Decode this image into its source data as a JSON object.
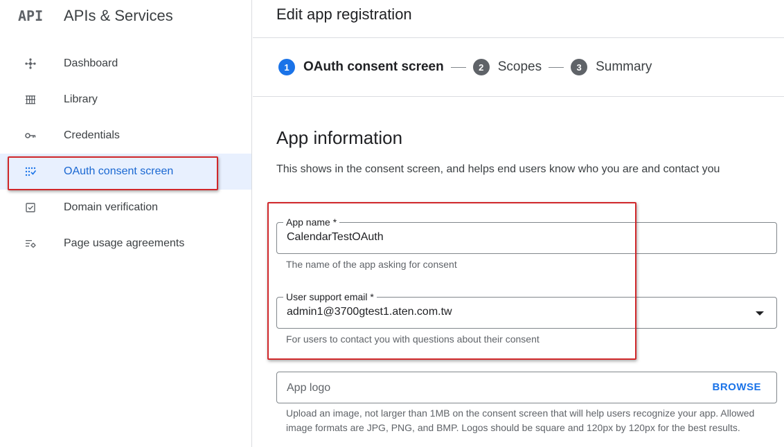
{
  "brand": {
    "logo": "API",
    "title": "APIs & Services"
  },
  "sidebar": {
    "items": [
      {
        "label": "Dashboard",
        "icon": "dashboard-icon"
      },
      {
        "label": "Library",
        "icon": "library-icon"
      },
      {
        "label": "Credentials",
        "icon": "key-icon"
      },
      {
        "label": "OAuth consent screen",
        "icon": "consent-icon",
        "active": true
      },
      {
        "label": "Domain verification",
        "icon": "checkbox-icon"
      },
      {
        "label": "Page usage agreements",
        "icon": "settings-list-icon"
      }
    ]
  },
  "page": {
    "title": "Edit app registration"
  },
  "stepper": {
    "steps": [
      {
        "num": "1",
        "label": "OAuth consent screen",
        "active": true
      },
      {
        "num": "2",
        "label": "Scopes",
        "active": false
      },
      {
        "num": "3",
        "label": "Summary",
        "active": false
      }
    ]
  },
  "app_info": {
    "title": "App information",
    "desc": "This shows in the consent screen, and helps end users know who you are and contact you"
  },
  "form": {
    "app_name": {
      "label": "App name *",
      "value": "CalendarTestOAuth",
      "helper": "The name of the app asking for consent"
    },
    "support_email": {
      "label": "User support email *",
      "value": "admin1@3700gtest1.aten.com.tw",
      "helper": "For users to contact you with questions about their consent"
    },
    "app_logo": {
      "placeholder": "App logo",
      "browse": "BROWSE",
      "help": "Upload an image, not larger than 1MB on the consent screen that will help users recognize your app. Allowed image formats are JPG, PNG, and BMP. Logos should be square and 120px by 120px for the best results."
    }
  },
  "colors": {
    "accent": "#1a73e8",
    "active_bg": "#e8f0fe",
    "highlight": "#d0272a",
    "step_inactive": "#5f6368"
  }
}
